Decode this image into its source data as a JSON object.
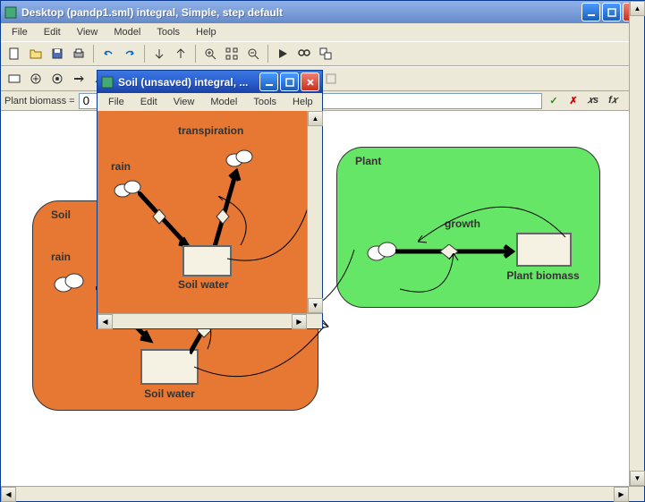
{
  "mainWindow": {
    "title": "Desktop (pandp1.sml) integral, Simple, step default",
    "menus": [
      "File",
      "Edit",
      "View",
      "Model",
      "Tools",
      "Help"
    ]
  },
  "childWindow": {
    "title": "Soil (unsaved) integral, ...",
    "menus": [
      "File",
      "Edit",
      "View",
      "Model",
      "Tools",
      "Help"
    ]
  },
  "formula": {
    "label": "Plant biomass =",
    "value": "0"
  },
  "mainDiagram": {
    "soil": {
      "label": "Soil",
      "rain": "rain",
      "compartment": "Soil water"
    },
    "plant": {
      "label": "Plant",
      "growth": "growth",
      "compartment": "Plant biomass"
    }
  },
  "childDiagram": {
    "rain": "rain",
    "transpiration": "transpiration",
    "compartment": "Soil water"
  },
  "chart_data": {
    "type": "diagram",
    "description": "System dynamics model (Simile). Main canvas has two submodels: Soil (orange) with inflow 'rain' to compartment 'Soil water', and Plant (green) with flow 'growth' into compartment 'Plant biomass'. Arrows connect Soil water to Plant. Child window shows Soil submodel enlarged: 'rain' inflow and 'transpiration' outflow on compartment 'Soil water', feedback loops drawn."
  }
}
